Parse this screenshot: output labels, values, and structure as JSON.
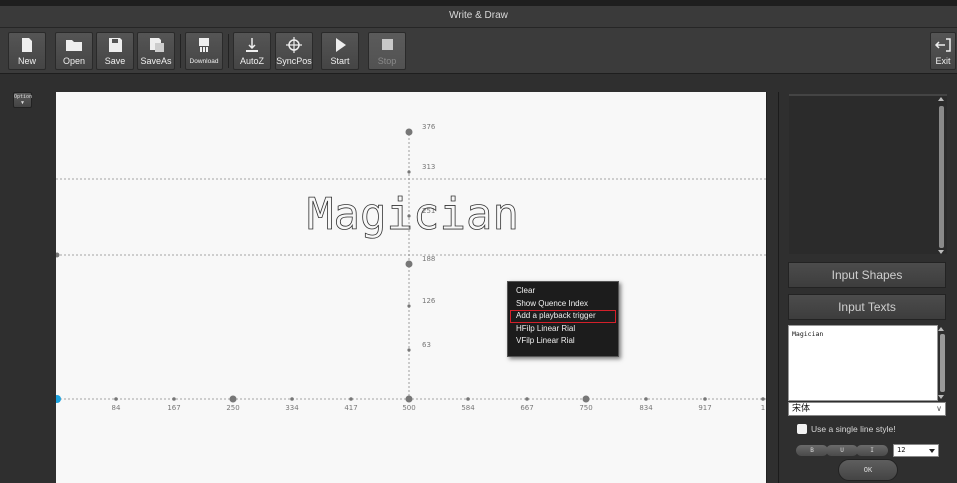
{
  "window": {
    "title": "Write & Draw"
  },
  "toolbar": {
    "new": "New",
    "open": "Open",
    "save": "Save",
    "saveas": "SaveAs",
    "download": "Download",
    "autoz": "AutoZ",
    "syncpos": "SyncPos",
    "start": "Start",
    "stop": "Stop",
    "exit": "Exit"
  },
  "left": {
    "option": "Option"
  },
  "canvas": {
    "text": "Magician",
    "y_ticks": [
      "376",
      "313",
      "251",
      "188",
      "126",
      "63"
    ],
    "x_ticks": [
      "84",
      "167",
      "250",
      "334",
      "417",
      "500",
      "584",
      "667",
      "750",
      "834",
      "917",
      "1"
    ]
  },
  "context_menu": {
    "items": [
      "Clear",
      "Show Quence Index",
      "Add a playback trigger",
      "HFilp Linear Rial",
      "VFilp Linear Rial"
    ],
    "highlighted": "Add a playback trigger"
  },
  "right_panel": {
    "input_shapes": "Input Shapes",
    "input_texts": "Input Texts",
    "text_value": "Magician",
    "font": "宋体",
    "single_line_label": "Use a single line style!",
    "bold": "B",
    "underline": "U",
    "italic": "I",
    "font_size": "12",
    "ok": "OK"
  },
  "colors": {
    "highlight_border": "#d4202a",
    "origin_dot": "#1aa3e0"
  }
}
